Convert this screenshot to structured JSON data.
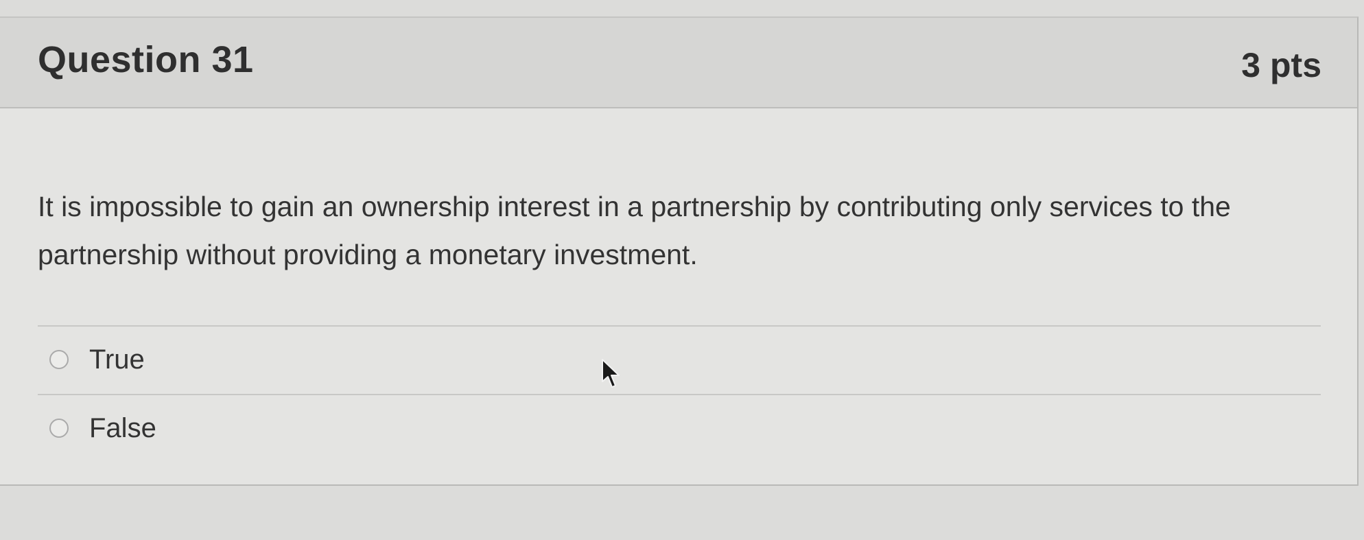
{
  "question": {
    "title": "Question 31",
    "points": "3 pts",
    "text": "It is impossible to gain an ownership interest in a partnership by contributing only services to the partnership without providing a monetary investment.",
    "answers": [
      {
        "label": "True",
        "selected": false
      },
      {
        "label": "False",
        "selected": false
      }
    ]
  },
  "colors": {
    "background": "#dcdcda",
    "header": "#d6d6d4",
    "text": "#333333"
  },
  "icons": {
    "radio": "radio-button-unchecked",
    "cursor": "mouse-pointer-arrow"
  }
}
